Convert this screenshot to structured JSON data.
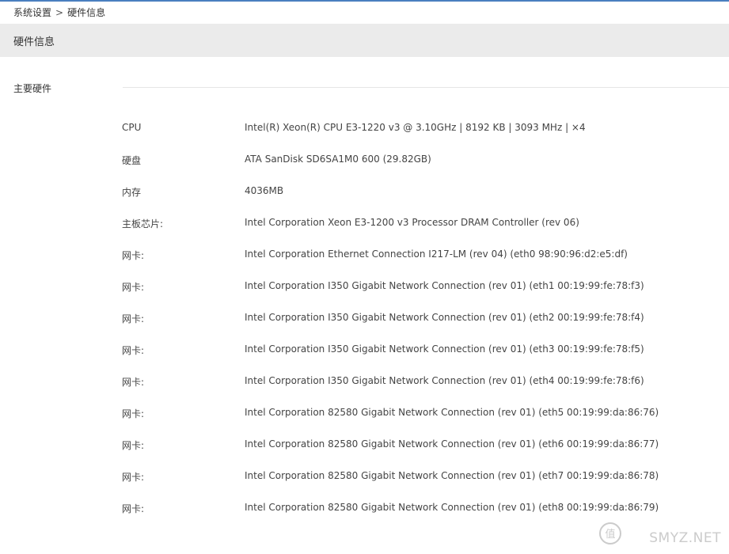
{
  "breadcrumb": {
    "parent": "系统设置",
    "separator": ">",
    "current": "硬件信息"
  },
  "page": {
    "title": "硬件信息"
  },
  "section": {
    "label": "主要硬件"
  },
  "hardware": [
    {
      "label": "CPU",
      "value": "Intel(R) Xeon(R) CPU E3-1220 v3 @ 3.10GHz | 8192 KB | 3093 MHz | ×4"
    },
    {
      "label": "硬盘",
      "value": "ATA SanDisk SD6SA1M0 600 (29.82GB)"
    },
    {
      "label": "内存",
      "value": "4036MB"
    },
    {
      "label": "主板芯片:",
      "value": "Intel Corporation Xeon E3-1200 v3 Processor DRAM Controller (rev 06)"
    },
    {
      "label": "网卡:",
      "value": "Intel Corporation Ethernet Connection I217-LM (rev 04) (eth0 98:90:96:d2:e5:df)"
    },
    {
      "label": "网卡:",
      "value": "Intel Corporation I350 Gigabit Network Connection (rev 01) (eth1 00:19:99:fe:78:f3)"
    },
    {
      "label": "网卡:",
      "value": "Intel Corporation I350 Gigabit Network Connection (rev 01) (eth2 00:19:99:fe:78:f4)"
    },
    {
      "label": "网卡:",
      "value": "Intel Corporation I350 Gigabit Network Connection (rev 01) (eth3 00:19:99:fe:78:f5)"
    },
    {
      "label": "网卡:",
      "value": "Intel Corporation I350 Gigabit Network Connection (rev 01) (eth4 00:19:99:fe:78:f6)"
    },
    {
      "label": "网卡:",
      "value": "Intel Corporation 82580 Gigabit Network Connection (rev 01) (eth5 00:19:99:da:86:76)"
    },
    {
      "label": "网卡:",
      "value": "Intel Corporation 82580 Gigabit Network Connection (rev 01) (eth6 00:19:99:da:86:77)"
    },
    {
      "label": "网卡:",
      "value": "Intel Corporation 82580 Gigabit Network Connection (rev 01) (eth7 00:19:99:da:86:78)"
    },
    {
      "label": "网卡:",
      "value": "Intel Corporation 82580 Gigabit Network Connection (rev 01) (eth8 00:19:99:da:86:79)"
    }
  ],
  "watermark": {
    "text": "SMYZ.NET",
    "icon": "smzdm-logo-icon"
  },
  "colors": {
    "accent": "#4a7fbf",
    "title_bar_bg": "#ebebeb",
    "text": "#444444"
  }
}
